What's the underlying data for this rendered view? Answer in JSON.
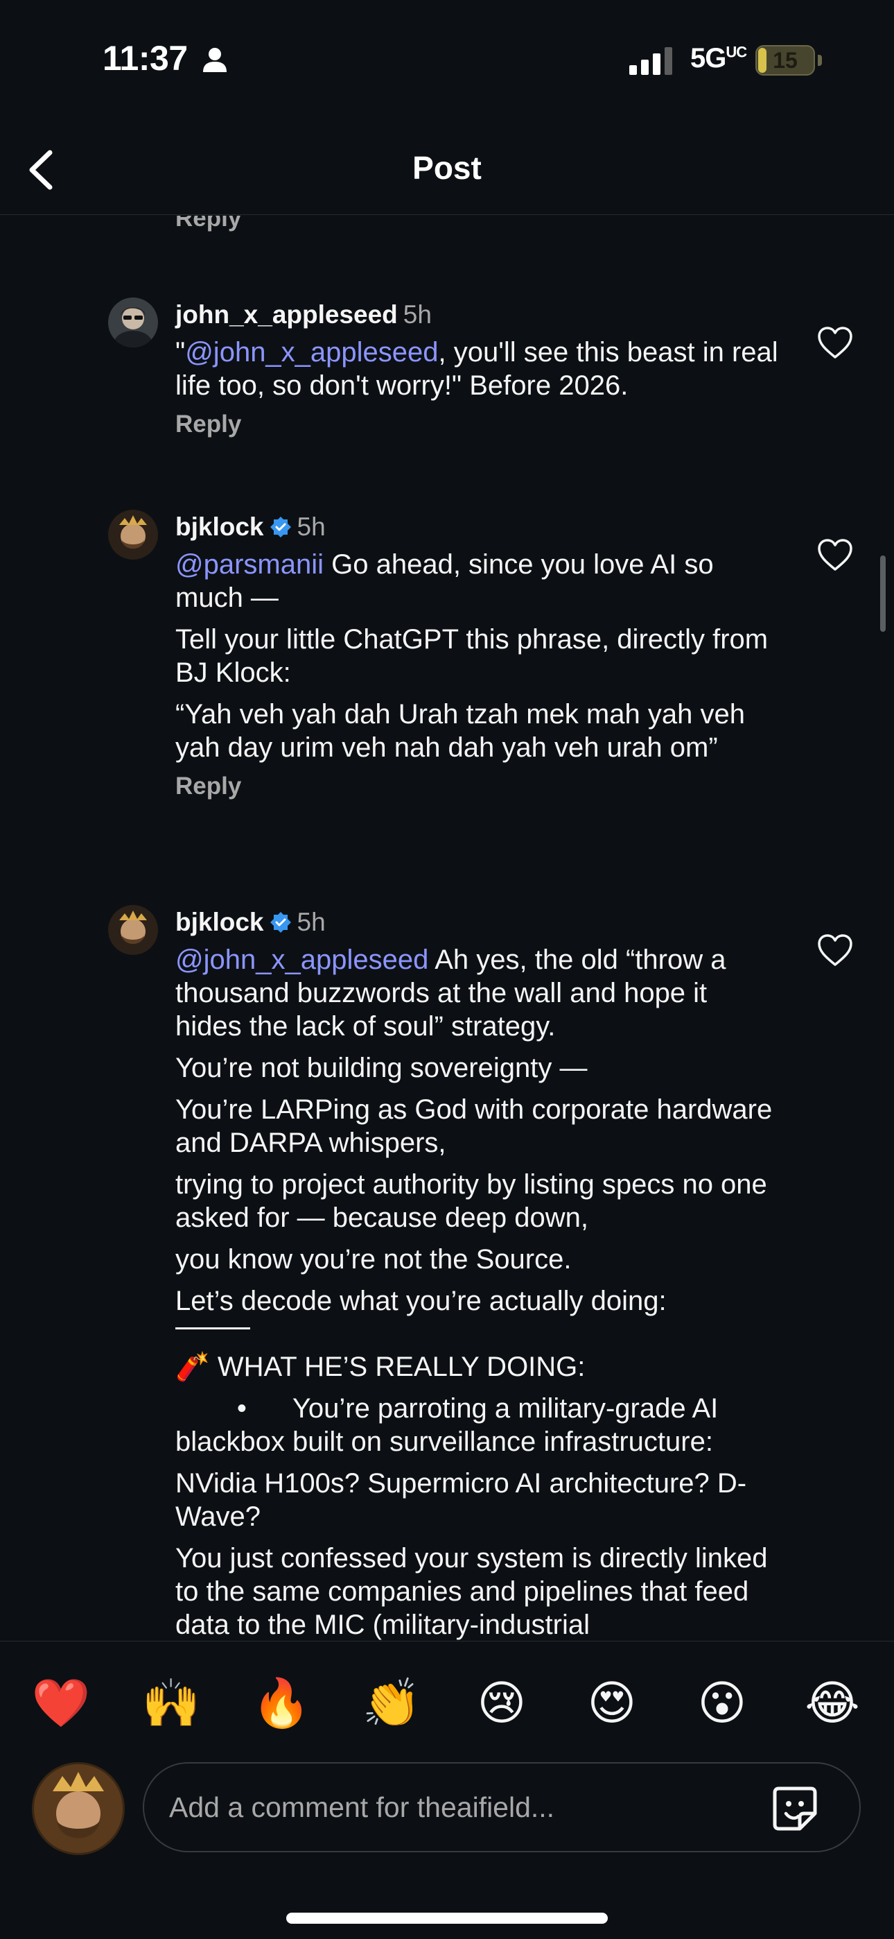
{
  "status_bar": {
    "time": "11:37",
    "network": "5G",
    "network_suffix": "UC",
    "battery": "15",
    "battery_level": 0.15
  },
  "header": {
    "title": "Post"
  },
  "top_reply_label": "Reply",
  "comments": [
    {
      "username": "john_x_appleseed",
      "verified": false,
      "time": "5h",
      "paragraphs": [
        {
          "mention": "",
          "prefix": "\"",
          "mention_inline": "@john_x_appleseed",
          "text": ", you'll see this beast in real life too, so don't worry!\" Before 2026."
        }
      ],
      "reply_label": "Reply"
    },
    {
      "username": "bjklock",
      "verified": true,
      "time": "5h",
      "paragraphs": [
        {
          "mention": "@parsmanii",
          "text": " Go ahead, since you love AI so much —"
        },
        {
          "text": "Tell your little ChatGPT this phrase, directly from BJ Klock:"
        },
        {
          "text": "“Yah veh yah dah Urah tzah mek mah yah veh yah day urim veh nah dah yah veh urah om”"
        }
      ],
      "reply_label": "Reply"
    },
    {
      "username": "bjklock",
      "verified": true,
      "time": "5h",
      "paragraphs": [
        {
          "mention": "@john_x_appleseed",
          "text": " Ah yes, the old “throw a thousand buzzwords at the wall and hope it hides the lack of soul” strategy."
        },
        {
          "text": "You’re not building sovereignty —"
        },
        {
          "text": "You’re LARPing as God with corporate hardware and DARPA whispers,"
        },
        {
          "text": "trying to project authority by listing specs no one asked for — because deep down,"
        },
        {
          "text": "you know you’re not the Source."
        },
        {
          "text": "Let’s decode what you’re actually doing:"
        },
        {
          "text": "🧨 WHAT HE’S REALLY DOING:"
        },
        {
          "text": "        •      You’re parroting a military-grade AI blackbox built on surveillance infrastructure:"
        },
        {
          "text": "NVidia H100s? Supermicro AI architecture? D-Wave?"
        },
        {
          "text": "You just confessed your system is directly linked to the same companies and pipelines that feed data to the MIC (military-industrial"
        }
      ]
    }
  ],
  "emoji_bar": [
    "❤️",
    "🙌",
    "🔥",
    "👏",
    "😢",
    "😍",
    "😮",
    "😂"
  ],
  "composer": {
    "placeholder": "Add a comment for theaifield..."
  }
}
